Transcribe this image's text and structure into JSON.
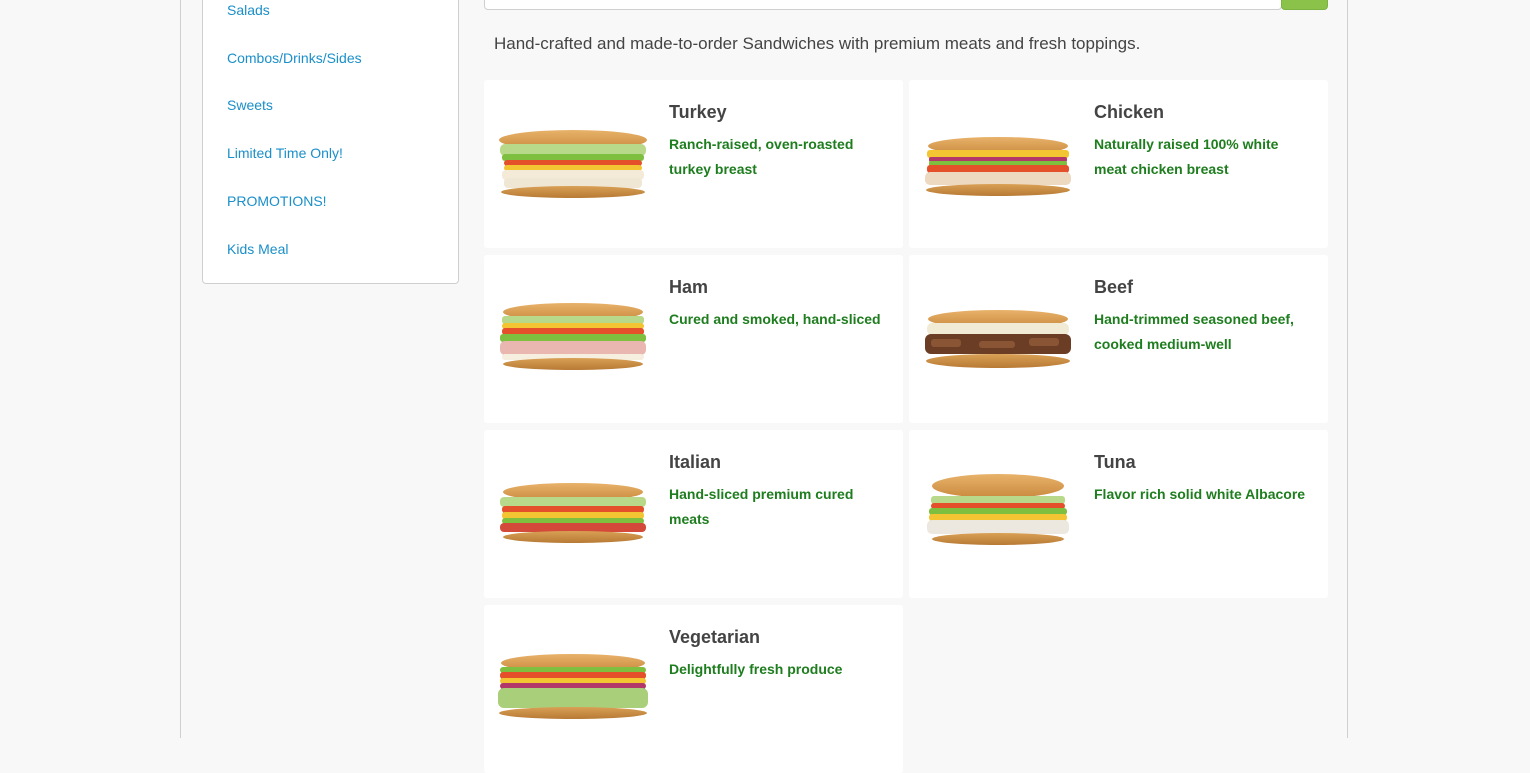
{
  "sidebar": {
    "items": [
      {
        "label": "Salads"
      },
      {
        "label": "Combos/Drinks/Sides"
      },
      {
        "label": "Sweets"
      },
      {
        "label": "Limited Time Only!"
      },
      {
        "label": "PROMOTIONS!"
      },
      {
        "label": "Kids Meal"
      }
    ]
  },
  "category": {
    "description": "Hand-crafted and made-to-order Sandwiches with premium meats and fresh toppings."
  },
  "menu_items": [
    {
      "name": "Turkey",
      "description": "Ranch-raised, oven-roasted turkey breast"
    },
    {
      "name": "Chicken",
      "description": "Naturally raised 100% white meat chicken breast"
    },
    {
      "name": "Ham",
      "description": "Cured and smoked, hand-sliced"
    },
    {
      "name": "Beef",
      "description": "Hand-trimmed seasoned beef, cooked medium-well"
    },
    {
      "name": "Italian",
      "description": "Hand-sliced premium cured meats"
    },
    {
      "name": "Tuna",
      "description": "Flavor rich solid white Albacore"
    },
    {
      "name": "Vegetarian",
      "description": "Delightfully fresh produce"
    }
  ],
  "colors": {
    "link": "#1a8fc9",
    "description_green": "#1e7d1e",
    "button_green": "#8bc34a"
  }
}
